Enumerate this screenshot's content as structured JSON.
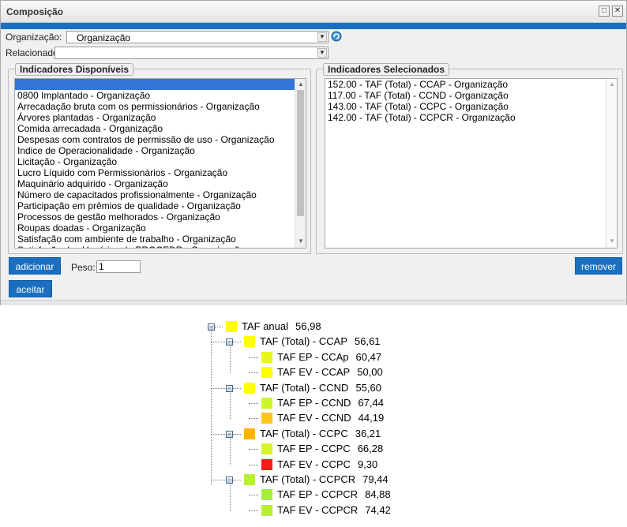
{
  "dialog": {
    "title": "Composição",
    "organizacao_label": "Organização:",
    "organizacao_value": "Organização",
    "relacionado_label": "Relacionado:",
    "relacionado_value": "",
    "disponiveis_legend": "Indicadores Disponíveis",
    "selecionados_legend": "Indicadores Selecionados",
    "disponiveis": [
      "",
      "0800 Implantado - Organização",
      "Arrecadação bruta com os permissionários - Organização",
      "Árvores plantadas - Organização",
      "Comida arrecadada - Organização",
      "Despesas com contratos de permissão de uso - Organização",
      "Indice de Operacionalidade - Organização",
      "Licitação - Organização",
      "Lucro Líquido com Permissionários - Organização",
      "Maquinário adquirido - Organização",
      "Número de capacitados profissionalmente - Organização",
      "Participação em prêmios de qualidade - Organização",
      "Processos de gestão melhorados - Organização",
      "Roupas doadas - Organização",
      "Satisfação com ambiente de trabalho - Organização",
      "Satisfação dos Usuários do PROCEDR - Organização"
    ],
    "selecionados": [
      "152.00 - TAF (Total) - CCAP - Organização",
      "117.00 - TAF (Total) - CCND - Organização",
      "143.00 - TAF (Total) - CCPC - Organização",
      "142.00 - TAF (Total) - CCPCR - Organização"
    ],
    "adicionar_label": "adicionar",
    "peso_label": "Peso:",
    "peso_value": "1",
    "remover_label": "remover",
    "aceitar_label": "aceitar"
  },
  "tree": {
    "root": {
      "label": "TAF anual",
      "value": "56,98",
      "color": "#ffff00"
    },
    "groups": [
      {
        "label": "TAF (Total) - CCAP",
        "value": "56,61",
        "color": "#ffff00",
        "children": [
          {
            "label": "TAF EP - CCAp",
            "value": "60,47",
            "color": "#e8f51c"
          },
          {
            "label": "TAF EV - CCAP",
            "value": "50,00",
            "color": "#ffff00"
          }
        ]
      },
      {
        "label": "TAF (Total) - CCND",
        "value": "55,60",
        "color": "#ffff00",
        "children": [
          {
            "label": "TAF EP - CCND",
            "value": "67,44",
            "color": "#ccf52a"
          },
          {
            "label": "TAF EV - CCND",
            "value": "44,19",
            "color": "#ffc61a"
          }
        ]
      },
      {
        "label": "TAF (Total) - CCPC",
        "value": "36,21",
        "color": "#ffb300",
        "children": [
          {
            "label": "TAF EP - CCPC",
            "value": "66,28",
            "color": "#d9f52a"
          },
          {
            "label": "TAF EV - CCPC",
            "value": "9,30",
            "color": "#ff1a1a"
          }
        ]
      },
      {
        "label": "TAF (Total) - CCPCR",
        "value": "79,44",
        "color": "#b8f02e",
        "children": [
          {
            "label": "TAF EP - CCPCR",
            "value": "84,88",
            "color": "#a6f03a"
          },
          {
            "label": "TAF EV - CCPCR",
            "value": "74,42",
            "color": "#b8f02e"
          }
        ]
      }
    ]
  }
}
